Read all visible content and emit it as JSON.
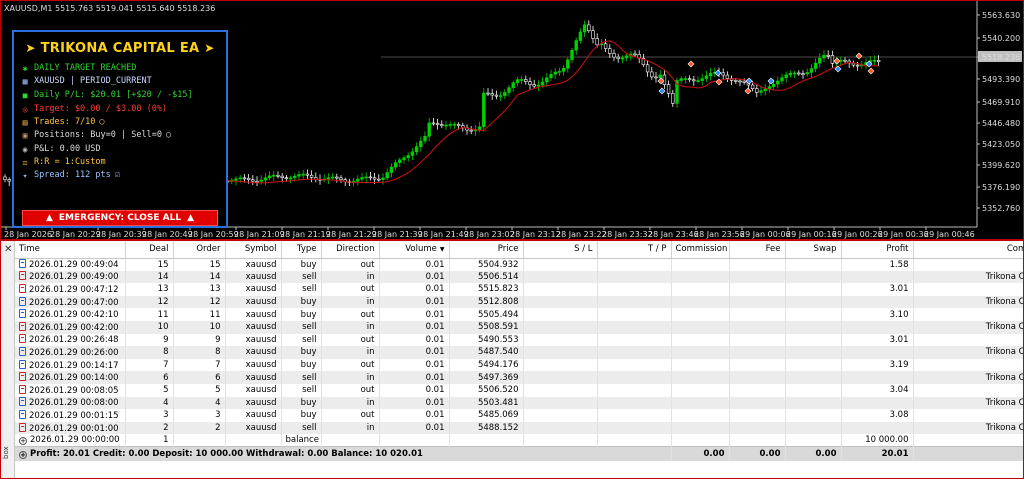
{
  "chart": {
    "symbol_line": "XAUUSD,M1  5515.763 5519.041 5515.640 5518.236",
    "price_labels": [
      "5563.630",
      "5540.200",
      "5518.236",
      "5493.390",
      "5469.910",
      "5446.480",
      "5423.050",
      "5399.620",
      "5376.190",
      "5352.760"
    ],
    "time_labels": [
      "28 Jan 2026",
      "28 Jan 20:29",
      "28 Jan 20:39",
      "28 Jan 20:49",
      "28 Jan 20:59",
      "28 Jan 21:09",
      "28 Jan 21:19",
      "28 Jan 21:29",
      "28 Jan 21:39",
      "28 Jan 21:49",
      "28 Jan 23:02",
      "28 Jan 23:12",
      "28 Jan 23:22",
      "28 Jan 23:32",
      "28 Jan 23:46",
      "28 Jan 23:56",
      "29 Jan 00:06",
      "29 Jan 00:16",
      "29 Jan 00:26",
      "29 Jan 00:36",
      "29 Jan 00:46"
    ],
    "colors": {
      "background": "#000000",
      "bull": "#00d000",
      "bear": "#ffffff",
      "ma": "#d01010",
      "grid": "#3a3a3a"
    }
  },
  "ea": {
    "title": "TRIKONA CAPITAL EA",
    "status": "DAILY TARGET REACHED",
    "symbol": "XAUUSD | PERIOD_CURRENT",
    "daily_pl": "Daily P/L: $20.01 [+$20 / -$15]",
    "target": "Target: $0.00 / $3.00 (0%)",
    "trades": "Trades: 7/10",
    "positions": "Positions: Buy=0 | Sell=0",
    "pnl": "P&L: 0.00 USD",
    "rr": "R:R = 1:Custom",
    "spread": "Spread: 112 pts",
    "emergency_button": "EMERGENCY: CLOSE ALL"
  },
  "toolbox": {
    "side_label": "box",
    "columns": [
      "Time",
      "Deal",
      "Order",
      "Symbol",
      "Type",
      "Direction",
      "Volume",
      "Price",
      "S / L",
      "T / P",
      "Commission",
      "Fee",
      "Swap",
      "Profit",
      "Comment"
    ],
    "rows": [
      {
        "time": "2026.01.29 00:49:04",
        "deal": "15",
        "order": "15",
        "symbol": "xauusd",
        "type": "buy",
        "direction": "out",
        "volume": "0.01",
        "price": "5504.932",
        "sl": "",
        "tp": "",
        "commission": "",
        "fee": "",
        "swap": "",
        "profit": "1.58",
        "comment": ""
      },
      {
        "time": "2026.01.29 00:49:00",
        "deal": "14",
        "order": "14",
        "symbol": "xauusd",
        "type": "sell",
        "direction": "in",
        "volume": "0.01",
        "price": "5506.514",
        "sl": "",
        "tp": "",
        "commission": "",
        "fee": "",
        "swap": "",
        "profit": "",
        "comment": "Trikona Capital"
      },
      {
        "time": "2026.01.29 00:47:12",
        "deal": "13",
        "order": "13",
        "symbol": "xauusd",
        "type": "sell",
        "direction": "out",
        "volume": "0.01",
        "price": "5515.823",
        "sl": "",
        "tp": "",
        "commission": "",
        "fee": "",
        "swap": "",
        "profit": "3.01",
        "comment": ""
      },
      {
        "time": "2026.01.29 00:47:00",
        "deal": "12",
        "order": "12",
        "symbol": "xauusd",
        "type": "buy",
        "direction": "in",
        "volume": "0.01",
        "price": "5512.808",
        "sl": "",
        "tp": "",
        "commission": "",
        "fee": "",
        "swap": "",
        "profit": "",
        "comment": "Trikona Capital"
      },
      {
        "time": "2026.01.29 00:42:10",
        "deal": "11",
        "order": "11",
        "symbol": "xauusd",
        "type": "buy",
        "direction": "out",
        "volume": "0.01",
        "price": "5505.494",
        "sl": "",
        "tp": "",
        "commission": "",
        "fee": "",
        "swap": "",
        "profit": "3.10",
        "comment": ""
      },
      {
        "time": "2026.01.29 00:42:00",
        "deal": "10",
        "order": "10",
        "symbol": "xauusd",
        "type": "sell",
        "direction": "in",
        "volume": "0.01",
        "price": "5508.591",
        "sl": "",
        "tp": "",
        "commission": "",
        "fee": "",
        "swap": "",
        "profit": "",
        "comment": "Trikona Capital"
      },
      {
        "time": "2026.01.29 00:26:48",
        "deal": "9",
        "order": "9",
        "symbol": "xauusd",
        "type": "sell",
        "direction": "out",
        "volume": "0.01",
        "price": "5490.553",
        "sl": "",
        "tp": "",
        "commission": "",
        "fee": "",
        "swap": "",
        "profit": "3.01",
        "comment": ""
      },
      {
        "time": "2026.01.29 00:26:00",
        "deal": "8",
        "order": "8",
        "symbol": "xauusd",
        "type": "buy",
        "direction": "in",
        "volume": "0.01",
        "price": "5487.540",
        "sl": "",
        "tp": "",
        "commission": "",
        "fee": "",
        "swap": "",
        "profit": "",
        "comment": "Trikona Capital"
      },
      {
        "time": "2026.01.29 00:14:17",
        "deal": "7",
        "order": "7",
        "symbol": "xauusd",
        "type": "buy",
        "direction": "out",
        "volume": "0.01",
        "price": "5494.176",
        "sl": "",
        "tp": "",
        "commission": "",
        "fee": "",
        "swap": "",
        "profit": "3.19",
        "comment": ""
      },
      {
        "time": "2026.01.29 00:14:00",
        "deal": "6",
        "order": "6",
        "symbol": "xauusd",
        "type": "sell",
        "direction": "in",
        "volume": "0.01",
        "price": "5497.369",
        "sl": "",
        "tp": "",
        "commission": "",
        "fee": "",
        "swap": "",
        "profit": "",
        "comment": "Trikona Capital"
      },
      {
        "time": "2026.01.29 00:08:05",
        "deal": "5",
        "order": "5",
        "symbol": "xauusd",
        "type": "sell",
        "direction": "out",
        "volume": "0.01",
        "price": "5506.520",
        "sl": "",
        "tp": "",
        "commission": "",
        "fee": "",
        "swap": "",
        "profit": "3.04",
        "comment": ""
      },
      {
        "time": "2026.01.29 00:08:00",
        "deal": "4",
        "order": "4",
        "symbol": "xauusd",
        "type": "buy",
        "direction": "in",
        "volume": "0.01",
        "price": "5503.481",
        "sl": "",
        "tp": "",
        "commission": "",
        "fee": "",
        "swap": "",
        "profit": "",
        "comment": "Trikona Capital"
      },
      {
        "time": "2026.01.29 00:01:15",
        "deal": "3",
        "order": "3",
        "symbol": "xauusd",
        "type": "buy",
        "direction": "out",
        "volume": "0.01",
        "price": "5485.069",
        "sl": "",
        "tp": "",
        "commission": "",
        "fee": "",
        "swap": "",
        "profit": "3.08",
        "comment": ""
      },
      {
        "time": "2026.01.29 00:01:00",
        "deal": "2",
        "order": "2",
        "symbol": "xauusd",
        "type": "sell",
        "direction": "in",
        "volume": "0.01",
        "price": "5488.152",
        "sl": "",
        "tp": "",
        "commission": "",
        "fee": "",
        "swap": "",
        "profit": "",
        "comment": "Trikona Capital"
      },
      {
        "time": "2026.01.29 00:00:00",
        "deal": "1",
        "order": "",
        "symbol": "",
        "type": "balance",
        "direction": "",
        "volume": "",
        "price": "",
        "sl": "",
        "tp": "",
        "commission": "",
        "fee": "",
        "swap": "",
        "profit": "10 000.00",
        "comment": ""
      }
    ],
    "summary": {
      "text": "Profit: 20.01  Credit: 0.00  Deposit: 10 000.00  Withdrawal: 0.00  Balance: 10 020.01",
      "commission": "0.00",
      "fee": "0.00",
      "swap": "0.00",
      "profit": "20.01"
    }
  }
}
